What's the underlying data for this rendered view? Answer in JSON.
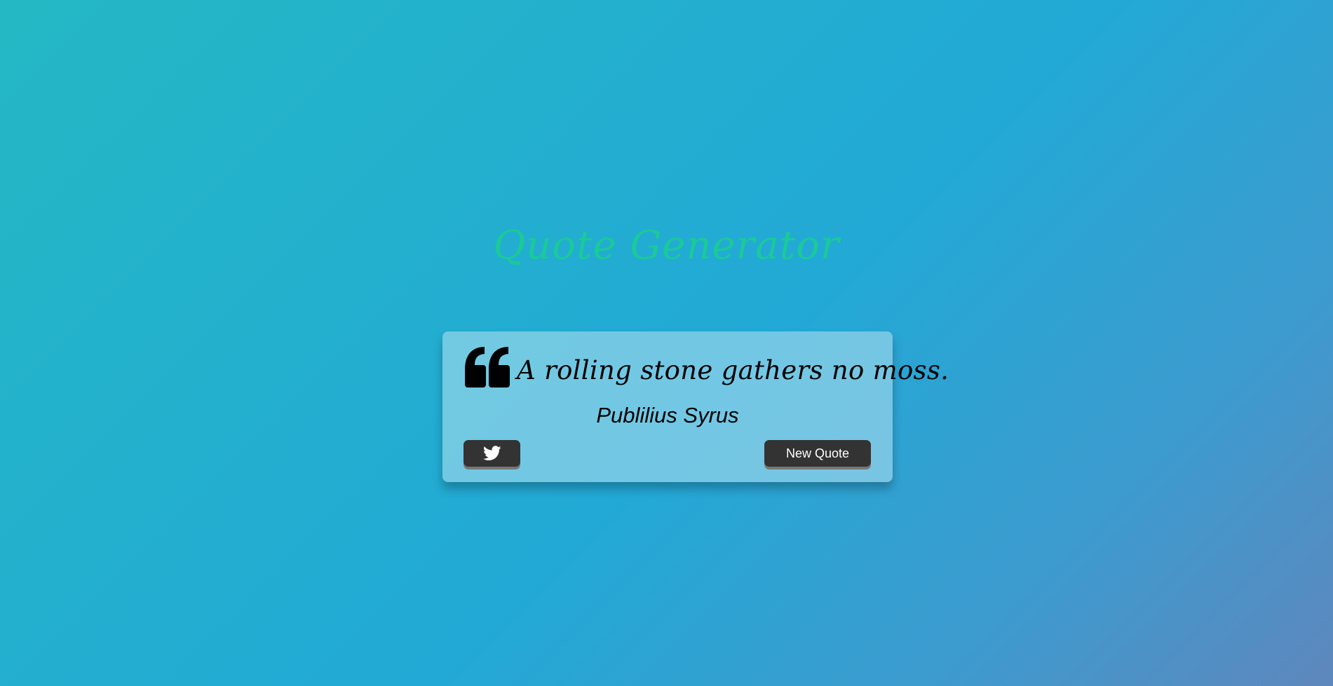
{
  "header": {
    "title": "Quote Generator"
  },
  "quote": {
    "text": "A rolling stone gathers no moss.",
    "author": "Publilius Syrus"
  },
  "buttons": {
    "twitter_icon": "twitter-icon",
    "new_quote_label": "New Quote"
  },
  "colors": {
    "title": "#19d08f",
    "button_bg": "#333333",
    "button_text": "#ffffff"
  }
}
